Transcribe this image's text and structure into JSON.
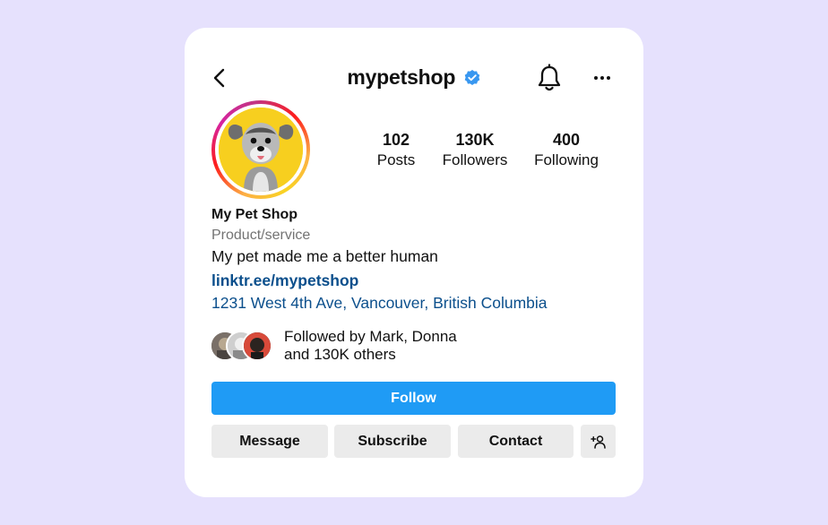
{
  "header": {
    "username": "mypetshop"
  },
  "stats": [
    {
      "value": "102",
      "label": "Posts"
    },
    {
      "value": "130K",
      "label": "Followers"
    },
    {
      "value": "400",
      "label": "Following"
    }
  ],
  "profile": {
    "name": "My Pet Shop",
    "category": "Product/service",
    "bio": "My pet made me a better human",
    "link": "linktr.ee/mypetshop",
    "address": "1231 West 4th Ave, Vancouver, British Columbia"
  },
  "followed_by": {
    "line1": "Followed by Mark, Donna",
    "line2": "and 130K others"
  },
  "buttons": {
    "follow": "Follow",
    "message": "Message",
    "subscribe": "Subscribe",
    "contact": "Contact"
  },
  "icons": {
    "back": "chevron-left-icon",
    "verified": "verified-badge-icon",
    "notifications": "bell-icon",
    "more": "more-horizontal-icon",
    "add_user": "add-user-icon"
  },
  "colors": {
    "background": "#e6e1fd",
    "follow_button": "#1f9bf5",
    "link": "#0b4f8c",
    "verified": "#3897f0",
    "secondary_button": "#ebebeb"
  }
}
